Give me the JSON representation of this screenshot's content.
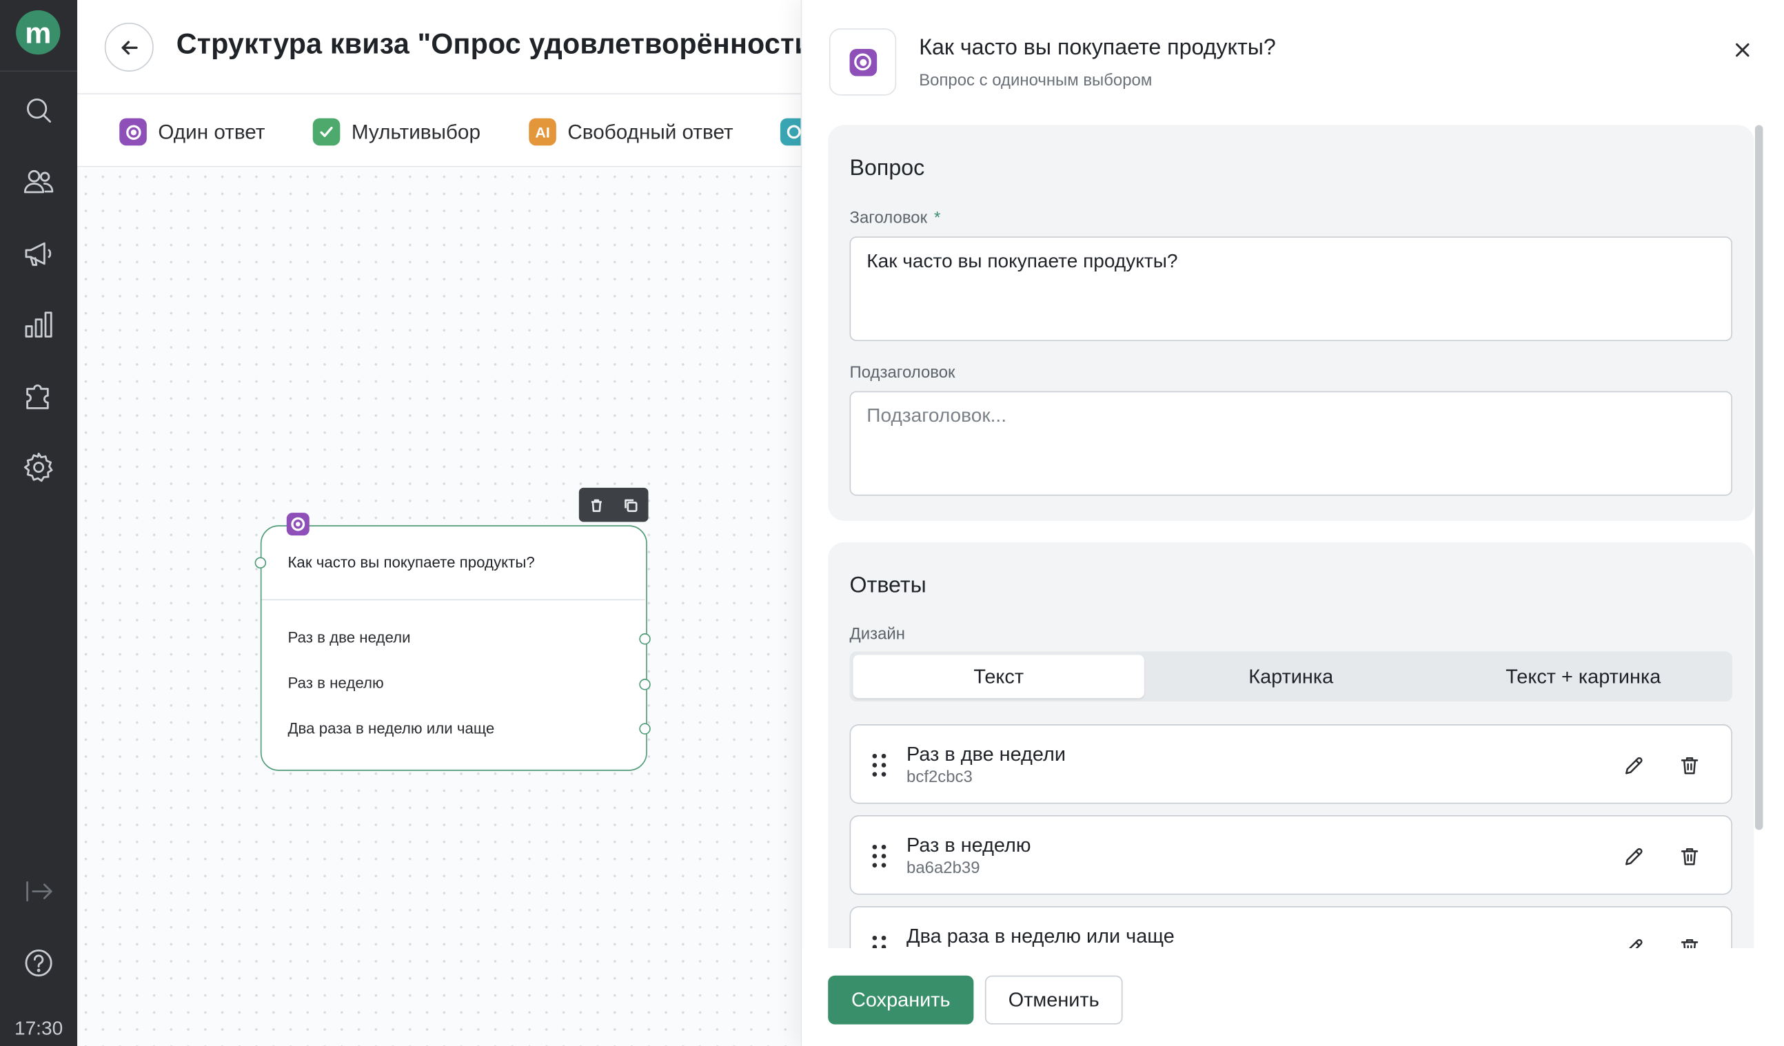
{
  "rail": {
    "logo_letter": "m",
    "icons": [
      "search-icon",
      "users-icon",
      "megaphone-icon",
      "chart-icon",
      "puzzle-icon",
      "gear-icon",
      "logout-icon",
      "help-icon"
    ],
    "time": "17:30"
  },
  "header": {
    "title": "Структура квиза \"Опрос удовлетворённости"
  },
  "toolbar": {
    "items": [
      {
        "label": "Один ответ",
        "icon": "radio-icon",
        "color": "#8e4fb8"
      },
      {
        "label": "Мультивыбор",
        "icon": "checkbox-icon",
        "color": "#4daa6c"
      },
      {
        "label": "Свободный ответ",
        "icon": "text-ai-icon",
        "color": "#e4973a"
      }
    ]
  },
  "node": {
    "title": "Как часто вы покупаете продукты?",
    "options": [
      "Раз в две недели",
      "Раз в неделю",
      "Два раза в неделю или чаще"
    ]
  },
  "panel": {
    "title": "Как часто вы покупаете продукты?",
    "subtitle": "Вопрос с одиночным выбором",
    "question_section": {
      "title": "Вопрос",
      "heading_label": "Заголовок",
      "required_mark": "*",
      "heading_value": "Как часто вы покупаете продукты?",
      "subheading_label": "Подзаголовок",
      "subheading_value": "",
      "subheading_placeholder": "Подзаголовок..."
    },
    "answers_section": {
      "title": "Ответы",
      "design_label": "Дизайн",
      "design_options": [
        "Текст",
        "Картинка",
        "Текст + картинка"
      ],
      "design_selected": "Текст",
      "answers": [
        {
          "title": "Раз в две недели",
          "id": "bcf2cbc3"
        },
        {
          "title": "Раз в неделю",
          "id": "ba6a2b39"
        },
        {
          "title": "Два раза в неделю или чаще",
          "id": ""
        }
      ]
    },
    "save_label": "Сохранить",
    "cancel_label": "Отменить"
  },
  "colors": {
    "accent": "#3a8f6b",
    "rail_bg": "#2b2d31",
    "single_choice": "#8e4fb8"
  }
}
